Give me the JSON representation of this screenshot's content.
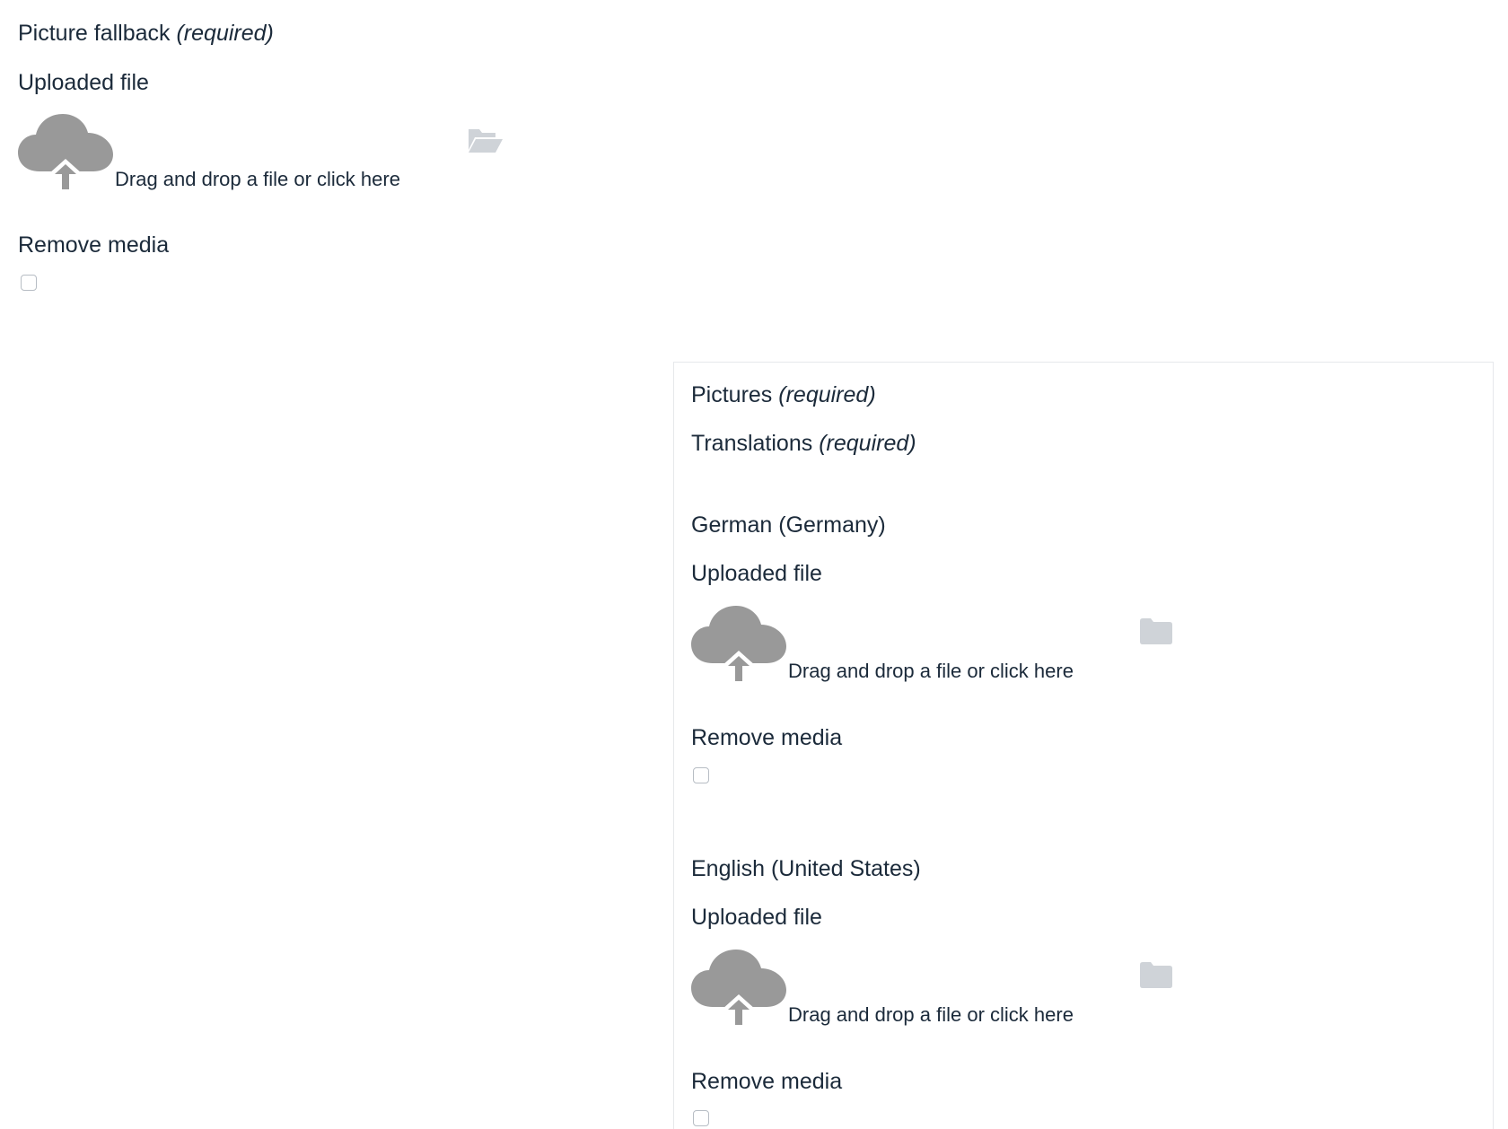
{
  "fallback": {
    "title": "Picture fallback",
    "required": "(required)",
    "uploaded_label": "Uploaded file",
    "dropzone_text": "Drag and drop a file or click here",
    "remove_label": "Remove media"
  },
  "pictures": {
    "title": "Pictures",
    "required": "(required)",
    "translations_title": "Translations",
    "translations_required": "(required)",
    "locales": [
      {
        "name": "German (Germany)",
        "uploaded_label": "Uploaded file",
        "dropzone_text": "Drag and drop a file or click here",
        "remove_label": "Remove media"
      },
      {
        "name": "English (United States)",
        "uploaded_label": "Uploaded file",
        "dropzone_text": "Drag and drop a file or click here",
        "remove_label": "Remove media"
      }
    ]
  },
  "icons": {
    "upload": "cloud-upload-icon",
    "browse_open": "folder-open-icon",
    "browse_closed": "folder-icon"
  },
  "colors": {
    "text": "#1b2a3a",
    "cloud": "#999999",
    "folder": "#cfd3d8",
    "checkbox_border": "#b7bdc4",
    "panel_border": "#e6e8eb"
  }
}
